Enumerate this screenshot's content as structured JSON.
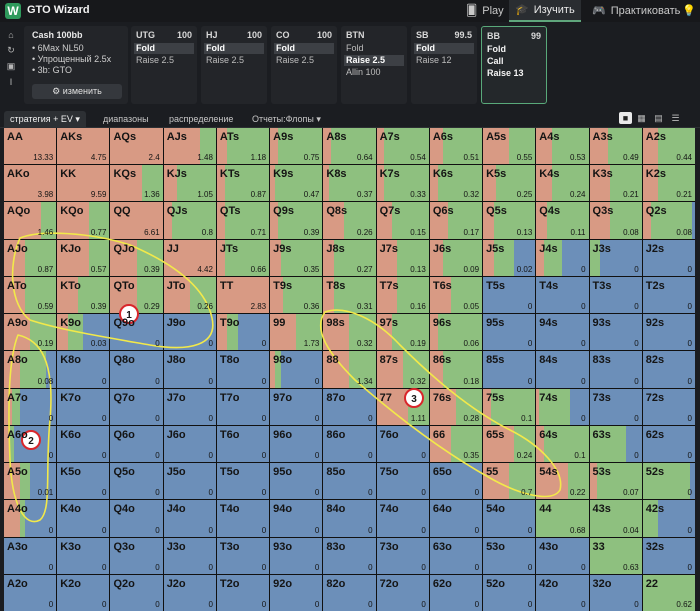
{
  "app": {
    "title": "GTO Wizard"
  },
  "nav": {
    "play": "Play",
    "study": "Изучить",
    "practice": "Практиковать"
  },
  "session": {
    "header": "Cash 100bb",
    "lines": [
      "6Max NL50",
      "Упрощенный 2.5x",
      "3b: GTO"
    ],
    "edit_label": "изменить"
  },
  "positions": [
    {
      "name": "UTG",
      "stack": "100",
      "options": [
        "Fold",
        "Raise 2.5"
      ],
      "selected": 0
    },
    {
      "name": "HJ",
      "stack": "100",
      "options": [
        "Fold",
        "Raise 2.5"
      ],
      "selected": 0
    },
    {
      "name": "CO",
      "stack": "100",
      "options": [
        "Fold",
        "Raise 2.5"
      ],
      "selected": 0
    },
    {
      "name": "BTN",
      "stack": "",
      "options": [
        "Fold",
        "Raise 2.5",
        "Allin 100"
      ],
      "selected": 1
    },
    {
      "name": "SB",
      "stack": "99.5",
      "options": [
        "Fold",
        "Raise 12"
      ],
      "selected": 0
    },
    {
      "name": "BB",
      "stack": "99",
      "options": [
        "Fold",
        "Call",
        "Raise 13"
      ],
      "selected": -1
    }
  ],
  "tabs": [
    {
      "label": "стратегия + EV ▾",
      "active": true
    },
    {
      "label": "диапазоны",
      "active": false
    },
    {
      "label": "распределение",
      "active": false
    },
    {
      "label": "Отчеты:Флопы ▾",
      "active": false
    }
  ],
  "colors": {
    "fold": "#6c8fb9",
    "call": "#8ec07f",
    "raise": "#d89a84",
    "accent": "#59a97a"
  },
  "annotations": [
    "1",
    "2",
    "3"
  ],
  "grid": [
    [
      [
        "AA",
        "13.33",
        0,
        0,
        1
      ],
      [
        "AKs",
        "4.75",
        0,
        0,
        1
      ],
      [
        "AQs",
        "2.4",
        0,
        0,
        1
      ],
      [
        "AJs",
        "1.48",
        0,
        0.3,
        0.7
      ],
      [
        "ATs",
        "1.18",
        0,
        0.8,
        0.2
      ],
      [
        "A9s",
        "0.75",
        0,
        0.85,
        0.15
      ],
      [
        "A8s",
        "0.64",
        0,
        0.85,
        0.15
      ],
      [
        "A7s",
        "0.54",
        0,
        0.85,
        0.15
      ],
      [
        "A6s",
        "0.51",
        0,
        0.75,
        0.25
      ],
      [
        "A5s",
        "0.55",
        0,
        0.5,
        0.5
      ],
      [
        "A4s",
        "0.53",
        0,
        0.7,
        0.3
      ],
      [
        "A3s",
        "0.49",
        0,
        0.65,
        0.35
      ],
      [
        "A2s",
        "0.44",
        0,
        0.7,
        0.3
      ]
    ],
    [
      [
        "AKo",
        "3.98",
        0,
        0,
        1
      ],
      [
        "KK",
        "9.59",
        0,
        0,
        1
      ],
      [
        "KQs",
        "1.36",
        0,
        0.4,
        0.6
      ],
      [
        "KJs",
        "1.05",
        0,
        0.75,
        0.25
      ],
      [
        "KTs",
        "0.87",
        0,
        0.85,
        0.15
      ],
      [
        "K9s",
        "0.47",
        0,
        0.9,
        0.1
      ],
      [
        "K8s",
        "0.37",
        0,
        0.9,
        0.1
      ],
      [
        "K7s",
        "0.33",
        0,
        0.85,
        0.15
      ],
      [
        "K6s",
        "0.32",
        0,
        0.85,
        0.15
      ],
      [
        "K5s",
        "0.25",
        0,
        0.75,
        0.25
      ],
      [
        "K4s",
        "0.24",
        0,
        0.7,
        0.3
      ],
      [
        "K3s",
        "0.21",
        0,
        0.6,
        0.4
      ],
      [
        "K2s",
        "0.21",
        0,
        0.7,
        0.3
      ]
    ],
    [
      [
        "AQo",
        "1.46",
        0,
        0.3,
        0.7
      ],
      [
        "KQo",
        "0.77",
        0,
        0.4,
        0.6
      ],
      [
        "QQ",
        "6.61",
        0,
        0,
        1
      ],
      [
        "QJs",
        "0.8",
        0,
        0.85,
        0.15
      ],
      [
        "QTs",
        "0.71",
        0,
        0.85,
        0.15
      ],
      [
        "Q9s",
        "0.39",
        0,
        0.85,
        0.15
      ],
      [
        "Q8s",
        "0.26",
        0,
        0.6,
        0.4
      ],
      [
        "Q7s",
        "0.15",
        0,
        0.7,
        0.3
      ],
      [
        "Q6s",
        "0.17",
        0,
        0.65,
        0.35
      ],
      [
        "Q5s",
        "0.13",
        0,
        0.8,
        0.2
      ],
      [
        "Q4s",
        "0.11",
        0,
        0.8,
        0.2
      ],
      [
        "Q3s",
        "0.08",
        0,
        0.6,
        0.4
      ],
      [
        "Q2s",
        "0.08",
        0.05,
        0.8,
        0.15
      ]
    ],
    [
      [
        "AJo",
        "0.87",
        0,
        0.6,
        0.4
      ],
      [
        "KJo",
        "0.57",
        0,
        0.4,
        0.6
      ],
      [
        "QJo",
        "0.39",
        0,
        0.5,
        0.5
      ],
      [
        "JJ",
        "4.42",
        0,
        0,
        1
      ],
      [
        "JTs",
        "0.66",
        0,
        0.85,
        0.15
      ],
      [
        "J9s",
        "0.35",
        0,
        0.8,
        0.2
      ],
      [
        "J8s",
        "0.27",
        0,
        0.8,
        0.2
      ],
      [
        "J7s",
        "0.13",
        0,
        0.6,
        0.4
      ],
      [
        "J6s",
        "0.09",
        0,
        0.75,
        0.25
      ],
      [
        "J5s",
        "0.02",
        0.4,
        0.4,
        0.2
      ],
      [
        "J4s",
        "0",
        0.5,
        0.35,
        0.15
      ],
      [
        "J3s",
        "0",
        0.8,
        0.2,
        0
      ],
      [
        "J2s",
        "0",
        1,
        0,
        0
      ]
    ],
    [
      [
        "ATo",
        "0.59",
        0,
        0.6,
        0.4
      ],
      [
        "KTo",
        "0.39",
        0,
        0.6,
        0.4
      ],
      [
        "QTo",
        "0.29",
        0,
        0.5,
        0.5
      ],
      [
        "JTo",
        "0.26",
        0,
        0.5,
        0.5
      ],
      [
        "TT",
        "2.83",
        0,
        0,
        1
      ],
      [
        "T9s",
        "0.36",
        0,
        0.75,
        0.25
      ],
      [
        "T8s",
        "0.31",
        0,
        0.8,
        0.2
      ],
      [
        "T7s",
        "0.16",
        0,
        0.6,
        0.4
      ],
      [
        "T6s",
        "0.05",
        0,
        0.6,
        0.4
      ],
      [
        "T5s",
        "0",
        1,
        0,
        0
      ],
      [
        "T4s",
        "0",
        1,
        0,
        0
      ],
      [
        "T3s",
        "0",
        1,
        0,
        0
      ],
      [
        "T2s",
        "0",
        1,
        0,
        0
      ]
    ],
    [
      [
        "A9o",
        "0.19",
        0,
        0.5,
        0.5
      ],
      [
        "K9o",
        "0.03",
        0.5,
        0.3,
        0.2
      ],
      [
        "Q9o",
        "0",
        1,
        0,
        0
      ],
      [
        "J9o",
        "0",
        1,
        0,
        0
      ],
      [
        "T9o",
        "0",
        0.6,
        0.2,
        0.2
      ],
      [
        "99",
        "1.73",
        0,
        0.5,
        0.5
      ],
      [
        "98s",
        "0.32",
        0,
        0.5,
        0.5
      ],
      [
        "97s",
        "0.19",
        0,
        0.7,
        0.3
      ],
      [
        "96s",
        "0.06",
        0,
        0.85,
        0.15
      ],
      [
        "95s",
        "0",
        1,
        0,
        0
      ],
      [
        "94s",
        "0",
        1,
        0,
        0
      ],
      [
        "93s",
        "0",
        1,
        0,
        0
      ],
      [
        "92s",
        "0",
        1,
        0,
        0
      ]
    ],
    [
      [
        "A8o",
        "0.08",
        0.2,
        0.5,
        0.3
      ],
      [
        "K8o",
        "0",
        1,
        0,
        0
      ],
      [
        "Q8o",
        "0",
        1,
        0,
        0
      ],
      [
        "J8o",
        "0",
        1,
        0,
        0
      ],
      [
        "T8o",
        "0",
        1,
        0,
        0
      ],
      [
        "98o",
        "0",
        0.8,
        0.1,
        0.1
      ],
      [
        "88",
        "1.34",
        0,
        0.5,
        0.5
      ],
      [
        "87s",
        "0.32",
        0,
        0.5,
        0.5
      ],
      [
        "86s",
        "0.18",
        0,
        0.75,
        0.25
      ],
      [
        "85s",
        "0",
        1,
        0,
        0
      ],
      [
        "84s",
        "0",
        1,
        0,
        0
      ],
      [
        "83s",
        "0",
        1,
        0,
        0
      ],
      [
        "82s",
        "0",
        1,
        0,
        0
      ]
    ],
    [
      [
        "A7o",
        "0",
        0.7,
        0.15,
        0.15
      ],
      [
        "K7o",
        "0",
        1,
        0,
        0
      ],
      [
        "Q7o",
        "0",
        1,
        0,
        0
      ],
      [
        "J7o",
        "0",
        1,
        0,
        0
      ],
      [
        "T7o",
        "0",
        1,
        0,
        0
      ],
      [
        "97o",
        "0",
        1,
        0,
        0
      ],
      [
        "87o",
        "0",
        1,
        0,
        0
      ],
      [
        "77",
        "1.11",
        0,
        0.4,
        0.6
      ],
      [
        "76s",
        "0.28",
        0,
        0.5,
        0.5
      ],
      [
        "75s",
        "0.1",
        0,
        0.85,
        0.15
      ],
      [
        "74s",
        "0",
        0.35,
        0.6,
        0.05
      ],
      [
        "73s",
        "0",
        1,
        0,
        0
      ],
      [
        "72s",
        "0",
        1,
        0,
        0
      ]
    ],
    [
      [
        "A6o",
        "0",
        0.8,
        0.1,
        0.1
      ],
      [
        "K6o",
        "0",
        1,
        0,
        0
      ],
      [
        "Q6o",
        "0",
        1,
        0,
        0
      ],
      [
        "J6o",
        "0",
        1,
        0,
        0
      ],
      [
        "T6o",
        "0",
        1,
        0,
        0
      ],
      [
        "96o",
        "0",
        1,
        0,
        0
      ],
      [
        "86o",
        "0",
        1,
        0,
        0
      ],
      [
        "76o",
        "0",
        1,
        0,
        0
      ],
      [
        "66",
        "0.35",
        0,
        0.6,
        0.4
      ],
      [
        "65s",
        "0.24",
        0,
        0.4,
        0.6
      ],
      [
        "64s",
        "0.1",
        0,
        0.85,
        0.15
      ],
      [
        "63s",
        "0",
        0.3,
        0.7,
        0
      ],
      [
        "62s",
        "0",
        1,
        0,
        0
      ]
    ],
    [
      [
        "A5o",
        "0.01",
        0.5,
        0.2,
        0.3
      ],
      [
        "K5o",
        "0",
        1,
        0,
        0
      ],
      [
        "Q5o",
        "0",
        1,
        0,
        0
      ],
      [
        "J5o",
        "0",
        1,
        0,
        0
      ],
      [
        "T5o",
        "0",
        1,
        0,
        0
      ],
      [
        "95o",
        "0",
        1,
        0,
        0
      ],
      [
        "85o",
        "0",
        1,
        0,
        0
      ],
      [
        "75o",
        "0",
        1,
        0,
        0
      ],
      [
        "65o",
        "0",
        1,
        0,
        0
      ],
      [
        "55",
        "0.7",
        0,
        0.5,
        0.5
      ],
      [
        "54s",
        "0.22",
        0,
        0.4,
        0.6
      ],
      [
        "53s",
        "0.07",
        0,
        0.85,
        0.15
      ],
      [
        "52s",
        "0",
        0.1,
        0.9,
        0
      ]
    ],
    [
      [
        "A4o",
        "0",
        0.6,
        0.1,
        0.3
      ],
      [
        "K4o",
        "0",
        1,
        0,
        0
      ],
      [
        "Q4o",
        "0",
        1,
        0,
        0
      ],
      [
        "J4o",
        "0",
        1,
        0,
        0
      ],
      [
        "T4o",
        "0",
        1,
        0,
        0
      ],
      [
        "94o",
        "0",
        1,
        0,
        0
      ],
      [
        "84o",
        "0",
        1,
        0,
        0
      ],
      [
        "74o",
        "0",
        1,
        0,
        0
      ],
      [
        "64o",
        "0",
        1,
        0,
        0
      ],
      [
        "54o",
        "0",
        1,
        0,
        0
      ],
      [
        "44",
        "0.68",
        0,
        1,
        0
      ],
      [
        "43s",
        "0.04",
        0,
        1,
        0
      ],
      [
        "42s",
        "0",
        0.7,
        0.3,
        0
      ]
    ],
    [
      [
        "A3o",
        "0",
        1,
        0,
        0
      ],
      [
        "K3o",
        "0",
        1,
        0,
        0
      ],
      [
        "Q3o",
        "0",
        1,
        0,
        0
      ],
      [
        "J3o",
        "0",
        1,
        0,
        0
      ],
      [
        "T3o",
        "0",
        1,
        0,
        0
      ],
      [
        "93o",
        "0",
        1,
        0,
        0
      ],
      [
        "83o",
        "0",
        1,
        0,
        0
      ],
      [
        "73o",
        "0",
        1,
        0,
        0
      ],
      [
        "63o",
        "0",
        1,
        0,
        0
      ],
      [
        "53o",
        "0",
        1,
        0,
        0
      ],
      [
        "43o",
        "0",
        1,
        0,
        0
      ],
      [
        "33",
        "0.63",
        0,
        1,
        0
      ],
      [
        "32s",
        "0",
        1,
        0,
        0
      ]
    ],
    [
      [
        "A2o",
        "0",
        1,
        0,
        0
      ],
      [
        "K2o",
        "0",
        1,
        0,
        0
      ],
      [
        "Q2o",
        "0",
        1,
        0,
        0
      ],
      [
        "J2o",
        "0",
        1,
        0,
        0
      ],
      [
        "T2o",
        "0",
        1,
        0,
        0
      ],
      [
        "92o",
        "0",
        1,
        0,
        0
      ],
      [
        "82o",
        "0",
        1,
        0,
        0
      ],
      [
        "72o",
        "0",
        1,
        0,
        0
      ],
      [
        "62o",
        "0",
        1,
        0,
        0
      ],
      [
        "52o",
        "0",
        1,
        0,
        0
      ],
      [
        "42o",
        "0",
        1,
        0,
        0
      ],
      [
        "32o",
        "0",
        1,
        0,
        0
      ],
      [
        "22",
        "0.62",
        0,
        1,
        0
      ]
    ]
  ]
}
